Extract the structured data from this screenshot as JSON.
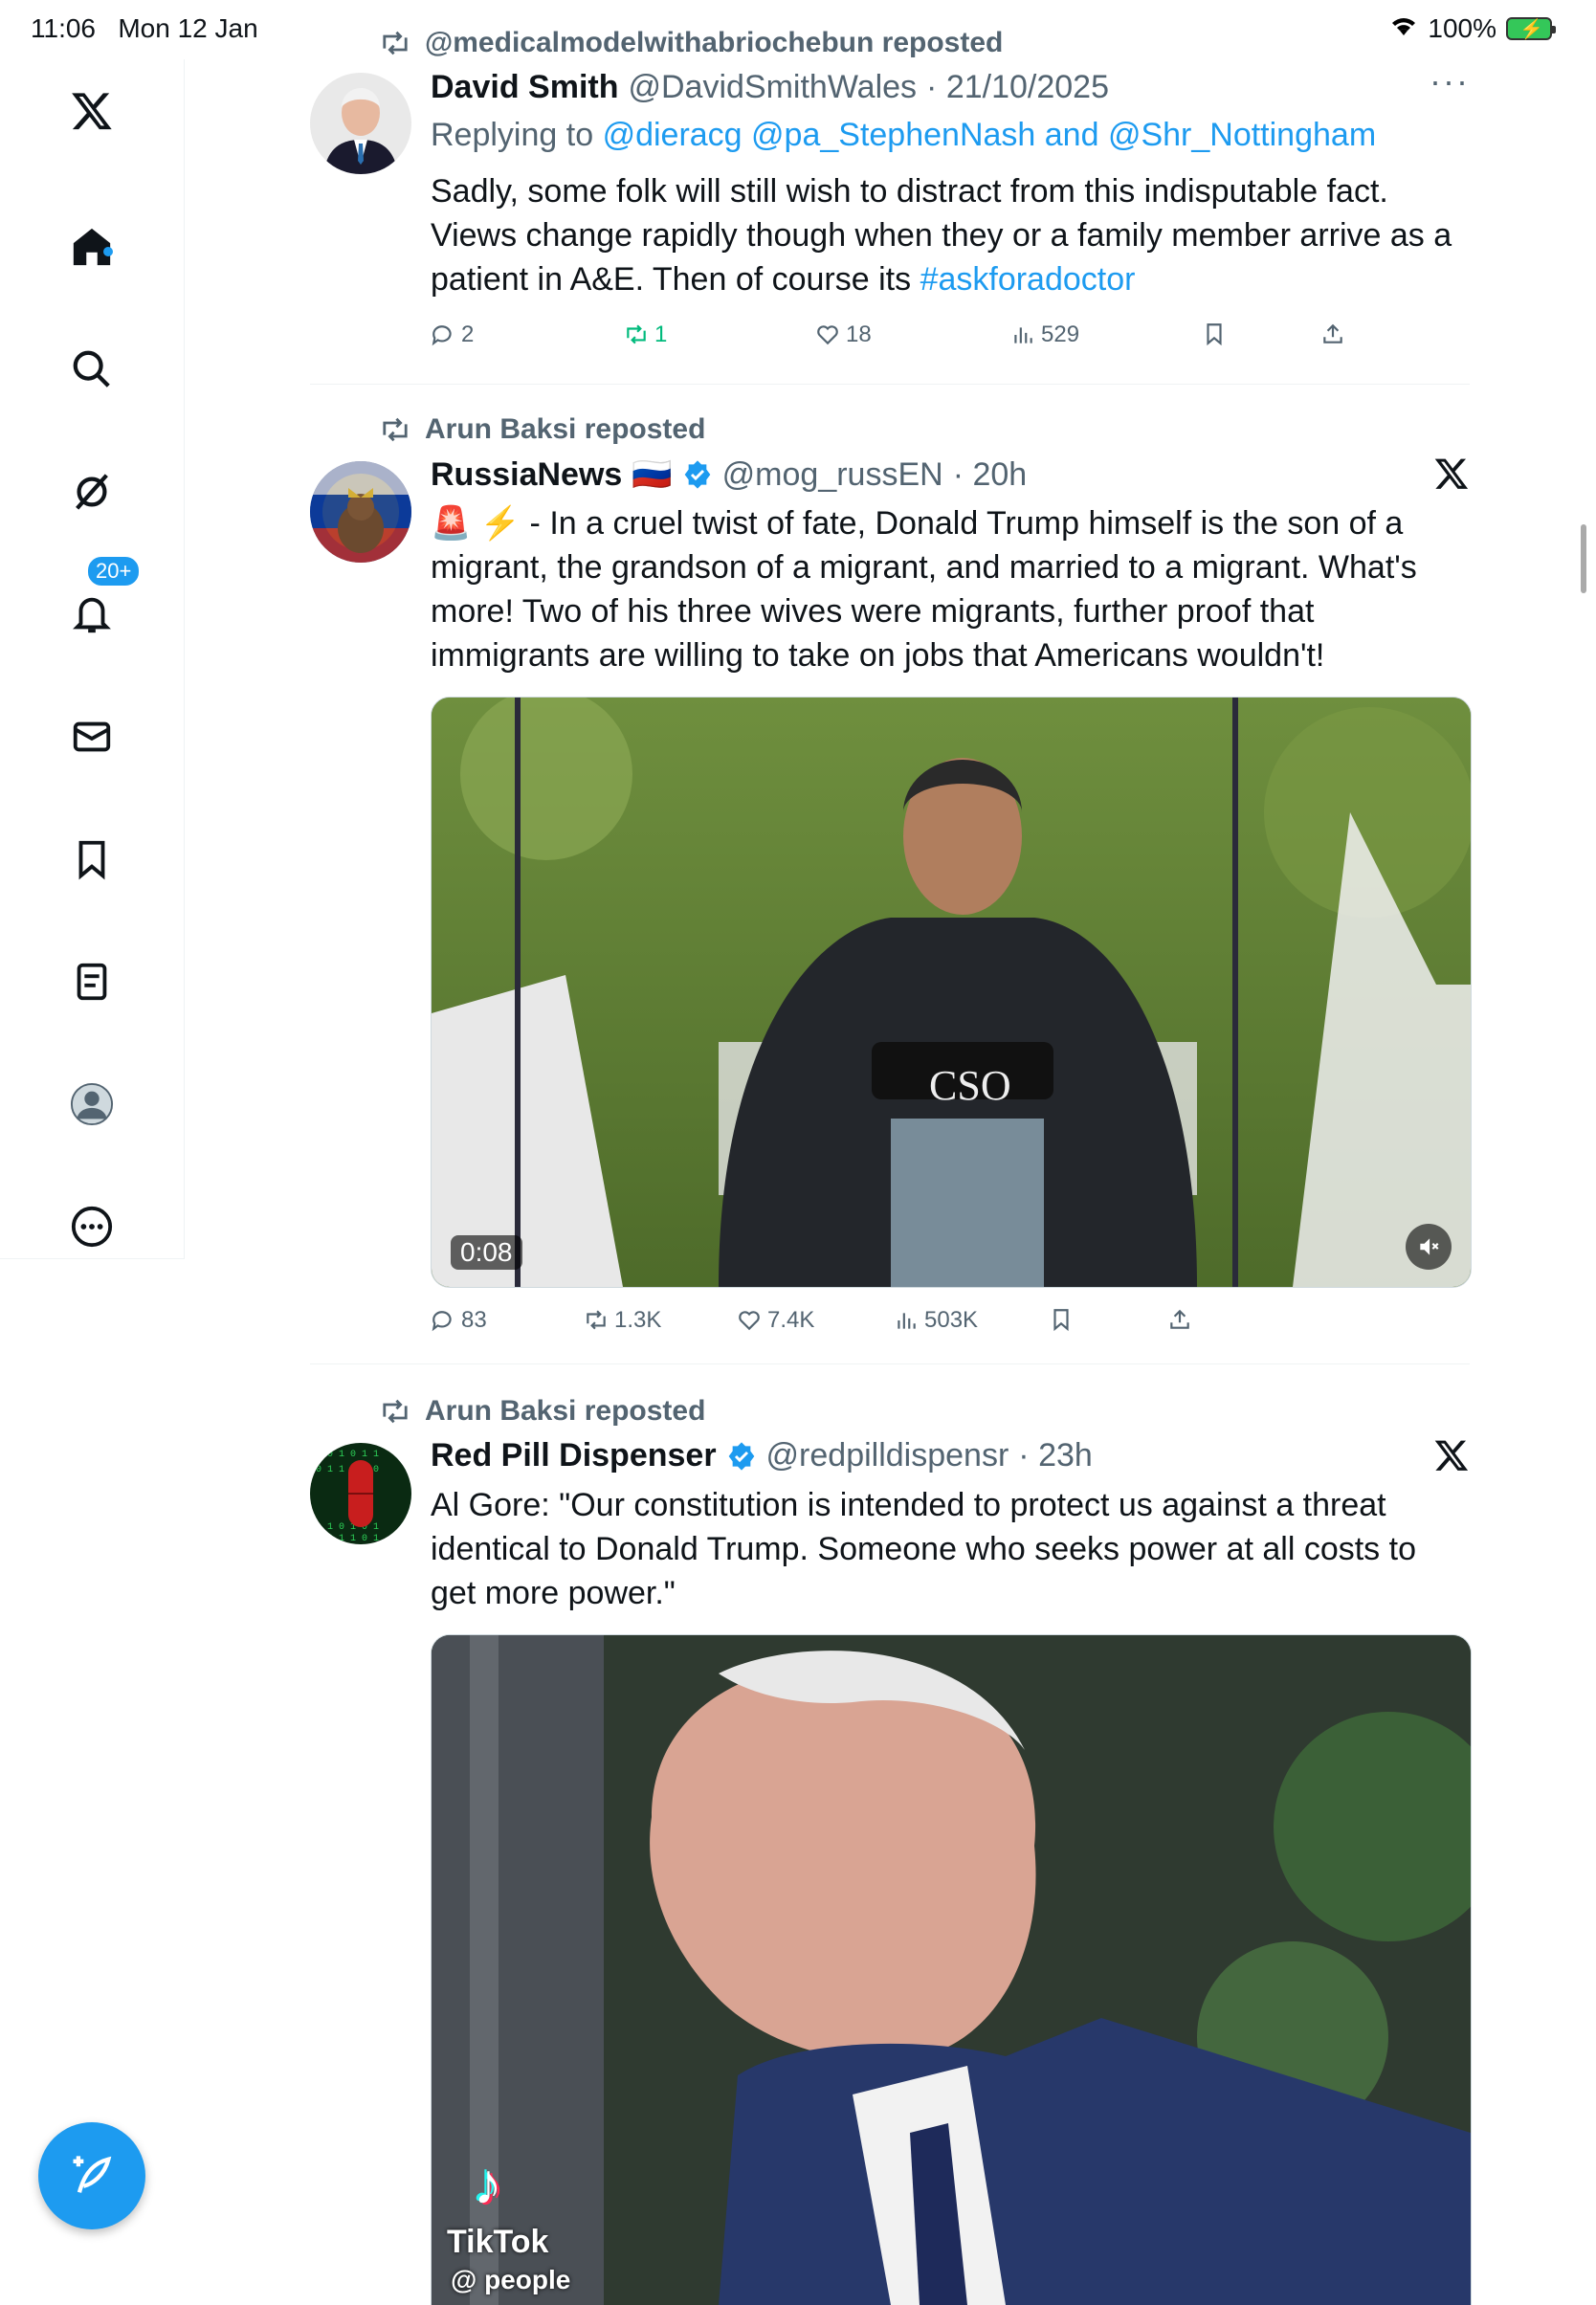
{
  "status_bar": {
    "time": "11:06",
    "date": "Mon 12 Jan",
    "battery": "100%",
    "wifi_icon": "wifi-icon"
  },
  "sidebar": {
    "items": [
      {
        "name": "x-logo",
        "icon": "x-logo-icon"
      },
      {
        "name": "home",
        "icon": "home-icon"
      },
      {
        "name": "search",
        "icon": "search-icon"
      },
      {
        "name": "grok",
        "icon": "grok-icon"
      },
      {
        "name": "notifications",
        "icon": "bell-icon"
      },
      {
        "name": "messages",
        "icon": "mail-icon"
      },
      {
        "name": "bookmarks",
        "icon": "bookmark-icon"
      },
      {
        "name": "lists",
        "icon": "list-icon"
      },
      {
        "name": "profile",
        "icon": "avatar-icon"
      },
      {
        "name": "more",
        "icon": "more-circle-icon"
      }
    ],
    "notification_badge": "20+",
    "compose_icon": "compose-icon"
  },
  "colors": {
    "accent": "#1d9bf0",
    "repost_active": "#00ba7c",
    "muted": "#536471"
  },
  "tweets": [
    {
      "repost_by": "@medicalmodelwithabriochebun reposted",
      "display_name": "David Smith",
      "handle": "@DavidSmithWales",
      "date": "· 21/10/2025",
      "replying_prefix": "Replying to",
      "replying_to": "@dieracg @pa_StephenNash and @Shr_Nottingham",
      "text": "Sadly, some folk will still wish to distract from this indisputable fact. Views change rapidly though when they or a family member arrive as a patient in A&E. Then of course its ",
      "hashtag": "#askforadoctor",
      "stats": {
        "replies": "2",
        "reposts": "1",
        "likes": "18",
        "views": "529"
      }
    },
    {
      "repost_by": "Arun Baksi reposted",
      "display_name": "RussiaNews",
      "flag": "🇷🇺",
      "handle": "@mog_russEN",
      "date": "· 20h",
      "text": "🚨 ⚡ - In a cruel twist of fate, Donald Trump himself is the son of a migrant, the grandson of a migrant, and married to a migrant. What's more! Two of his three wives were migrants, further proof that immigrants are willing to take on jobs that Americans wouldn't!",
      "video_duration": "0:08",
      "stats": {
        "replies": "83",
        "reposts": "1.3K",
        "likes": "7.4K",
        "views": "503K"
      }
    },
    {
      "repost_by": "Arun Baksi reposted",
      "display_name": "Red Pill Dispenser",
      "handle": "@redpilldispensr",
      "date": "· 23h",
      "text": "Al Gore: \"Our constitution is intended to protect us against a threat identical to Donald Trump. Someone who seeks power at all costs to get more power.\"",
      "tiktok_brand": "TikTok",
      "tiktok_user": "@ people"
    }
  ]
}
